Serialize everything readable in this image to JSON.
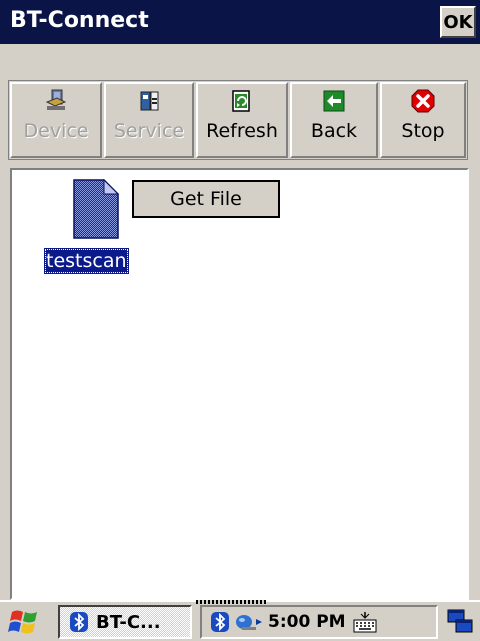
{
  "window": {
    "title": "BT-Connect",
    "ok_label": "OK"
  },
  "toolbar": {
    "buttons": [
      {
        "label": "Device",
        "icon": "device-icon",
        "enabled": false
      },
      {
        "label": "Service",
        "icon": "service-icon",
        "enabled": false
      },
      {
        "label": "Refresh",
        "icon": "refresh-icon",
        "enabled": true
      },
      {
        "label": "Back",
        "icon": "back-arrow-icon",
        "enabled": true
      },
      {
        "label": "Stop",
        "icon": "stop-icon",
        "enabled": true
      }
    ]
  },
  "content": {
    "context_button": "Get File",
    "files": [
      {
        "name": "testscan",
        "icon": "document-icon",
        "selected": true
      }
    ]
  },
  "taskbar": {
    "start_icon": "windows-flag-icon",
    "task_label": "BT-C...",
    "time": "5:00 PM",
    "tray_icons": [
      "bluetooth-icon",
      "network-icon",
      "keyboard-icon"
    ],
    "desktop_icon": "desktop-icon"
  },
  "colors": {
    "titlebar": "#0a1446",
    "selection": "#0a1a8a",
    "face": "#d4d0c8"
  }
}
